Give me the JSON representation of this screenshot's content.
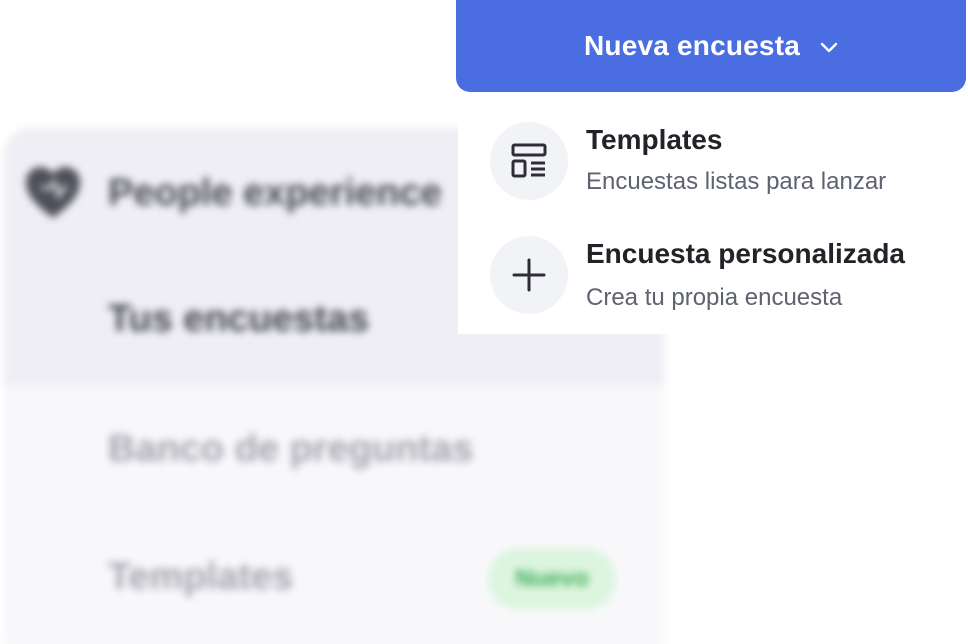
{
  "sidebar": {
    "section_title": "People experience",
    "section_icon": "heart-icon",
    "items": [
      {
        "label": "Tus encuestas",
        "active": true
      },
      {
        "label": "Banco de preguntas",
        "active": false
      },
      {
        "label": "Templates",
        "active": false,
        "badge": "Nuevo"
      }
    ]
  },
  "primary_button": {
    "label": "Nueva encuesta",
    "icon": "chevron-down-icon"
  },
  "dropdown": {
    "items": [
      {
        "title": "Templates",
        "subtitle": "Encuestas listas para lanzar",
        "icon": "template-layout-icon"
      },
      {
        "title": "Encuesta personalizada",
        "subtitle": "Crea tu propia encuesta",
        "icon": "plus-icon"
      }
    ]
  },
  "colors": {
    "primary": "#4a6ee2",
    "badge_bg": "#dcf5df",
    "badge_text": "#3fae55",
    "icon_circle": "#f2f3f7"
  }
}
